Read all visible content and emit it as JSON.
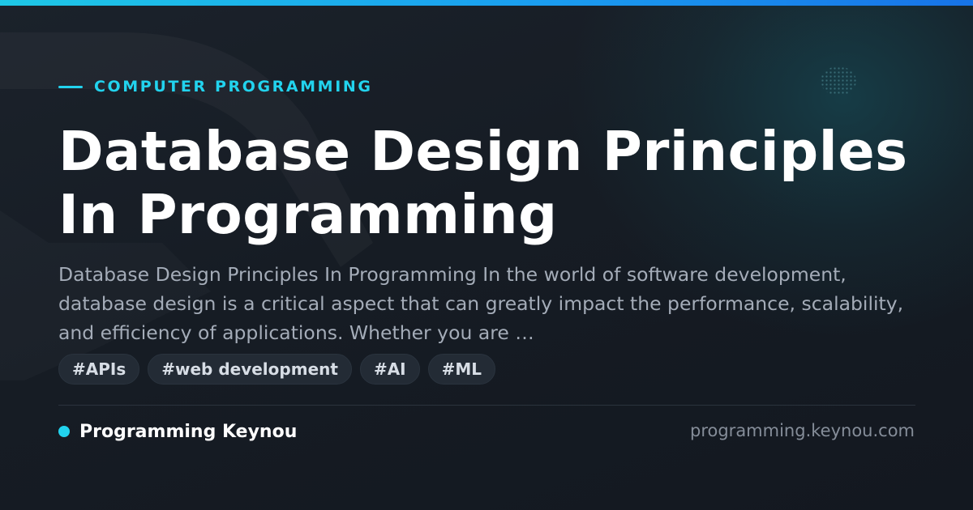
{
  "category": "COMPUTER PROGRAMMING",
  "title": "Database Design Principles In Programming",
  "excerpt": "Database Design Principles In Programming In the world of software development, database design is a critical aspect that can greatly impact the performance, scalability, and efficiency of applications. Whether you are …",
  "tags": [
    "#APIs",
    "#web development",
    "#AI",
    "#ML"
  ],
  "site": {
    "name": "Programming Keynou",
    "domain": "programming.keynou.com"
  },
  "colors": {
    "accent": "#22d3ee",
    "background": "#151b23",
    "title": "#ffffff",
    "excerpt": "#a4acb8",
    "tag_background": "#232b35",
    "domain_text": "#858d99"
  }
}
